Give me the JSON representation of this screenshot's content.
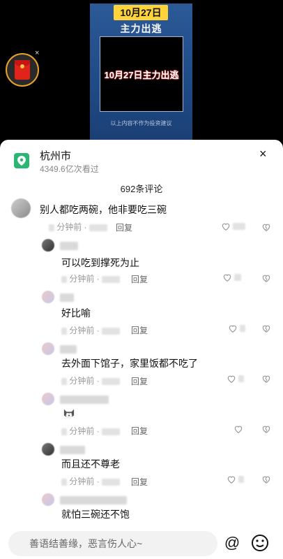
{
  "video": {
    "date_banner": "10月27日",
    "subtitle": "主力出逃",
    "box_text": "10月27日主力出逃",
    "disclaimer": "以上内容不作为投资建议"
  },
  "redpack": {
    "close": "×"
  },
  "location": {
    "title": "杭州市",
    "views": "4349.6亿次看过",
    "close": "×"
  },
  "comment_count": "692条评论",
  "reply_label": "回复",
  "comments": [
    {
      "text": "别人都吃两碗，他非要吃三碗",
      "time": "分钟前 ·"
    },
    {
      "text": "可以吃到撑死为止",
      "time": "分钟前 ·"
    },
    {
      "text": "好比喻",
      "time": "分钟前 ·"
    },
    {
      "text": "去外面下馆子，家里饭都不吃了",
      "time": "分钟前 ·"
    },
    {
      "text": "",
      "time": "分钟前 ·",
      "emoji": "dog-face-icon"
    },
    {
      "text": "而且还不尊老",
      "time": "分钟前 ·"
    },
    {
      "text": "就怕三碗还不饱",
      "time": ""
    }
  ],
  "input": {
    "placeholder": "善语结善缘，恶言伤人心~",
    "at": "@"
  },
  "colors": {
    "accent_green": "#2bb673",
    "banner_yellow": "#ffd43a",
    "redpack": "#e2231a"
  }
}
